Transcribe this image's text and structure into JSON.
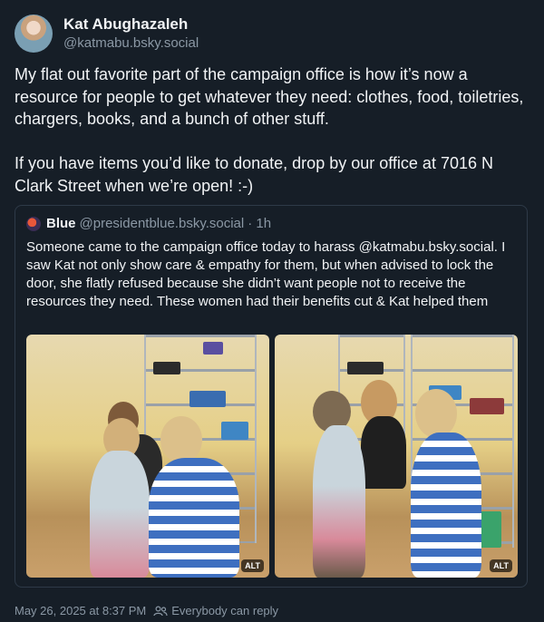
{
  "author": {
    "display_name": "Kat Abughazaleh",
    "handle": "@katmabu.bsky.social"
  },
  "post": {
    "paragraph_1": "My flat out favorite part of the campaign office is how it’s now a resource for people to get whatever they need: clothes, food, toiletries, chargers, books, and a bunch of other stuff.",
    "paragraph_2": "If you have items you’d like to donate, drop by our office at 7016 N Clark Street when we’re open! :-)"
  },
  "quote": {
    "name": "Blue",
    "handle": "@presidentblue.bsky.social",
    "time": "· 1h",
    "text": "Someone came to the campaign office today to harass @katmabu.bsky.social. I saw Kat not only show care & empathy for them, but when advised to lock the door, she flatly refused because she didn’t want people not to receive the resources they need. These women had their benefits cut & Kat helped them",
    "images": [
      {
        "alt_badge": "ALT"
      },
      {
        "alt_badge": "ALT"
      }
    ]
  },
  "footer": {
    "timestamp": "May 26, 2025 at 8:37 PM",
    "reply_setting": "Everybody can reply",
    "reply_icon": "people-icon"
  }
}
